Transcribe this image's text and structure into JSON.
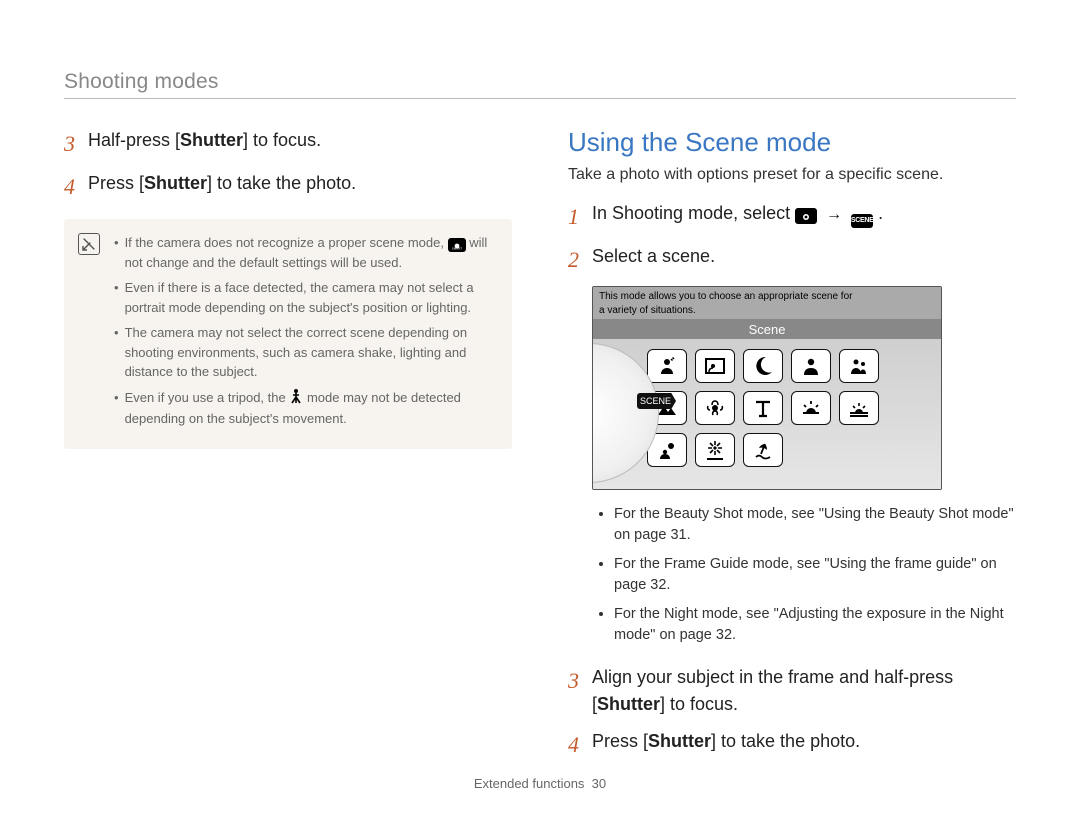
{
  "header": {
    "section_title": "Shooting modes"
  },
  "left": {
    "step3": {
      "num": "3",
      "pre": "Half-press [",
      "bold": "Shutter",
      "post": "] to focus."
    },
    "step4": {
      "num": "4",
      "pre": "Press [",
      "bold": "Shutter",
      "post": "] to take the photo."
    },
    "notes": {
      "item1_pre": "If the camera does not recognize a proper scene mode, ",
      "item1_post": " will not change and the default settings will be used.",
      "item2": "Even if there is a face detected, the camera may not select a portrait mode depending on the subject's position or lighting.",
      "item3": "The camera may not select the correct scene depending on shooting environments, such as camera shake, lighting and distance to the subject.",
      "item4_pre": "Even if you use a tripod, the ",
      "item4_post": " mode may not be detected depending on the subject's movement."
    }
  },
  "right": {
    "heading": "Using the Scene mode",
    "intro": "Take a photo with options preset for a specific scene.",
    "step1": {
      "num": "1",
      "pre": "In Shooting mode, select ",
      "post": "."
    },
    "step2": {
      "num": "2",
      "text": "Select a scene."
    },
    "screen": {
      "banner_line1": "This mode allows you to choose an appropriate scene for",
      "banner_line2": "a variety of situations.",
      "label": "Scene",
      "dial_tab": "SCENE"
    },
    "bullets": {
      "b1": "For the Beauty Shot mode, see \"Using the Beauty Shot mode\" on page 31.",
      "b2": "For the Frame Guide mode, see \"Using the frame guide\" on page 32.",
      "b3": "For the Night mode, see \"Adjusting the exposure in the Night mode\" on page 32."
    },
    "step3": {
      "num": "3",
      "pre": "Align your subject in the frame and half-press [",
      "bold": "Shutter",
      "post": "] to focus."
    },
    "step4": {
      "num": "4",
      "pre": "Press [",
      "bold": "Shutter",
      "post": "] to take the photo."
    }
  },
  "footer": {
    "label": "Extended functions",
    "page": "30"
  }
}
